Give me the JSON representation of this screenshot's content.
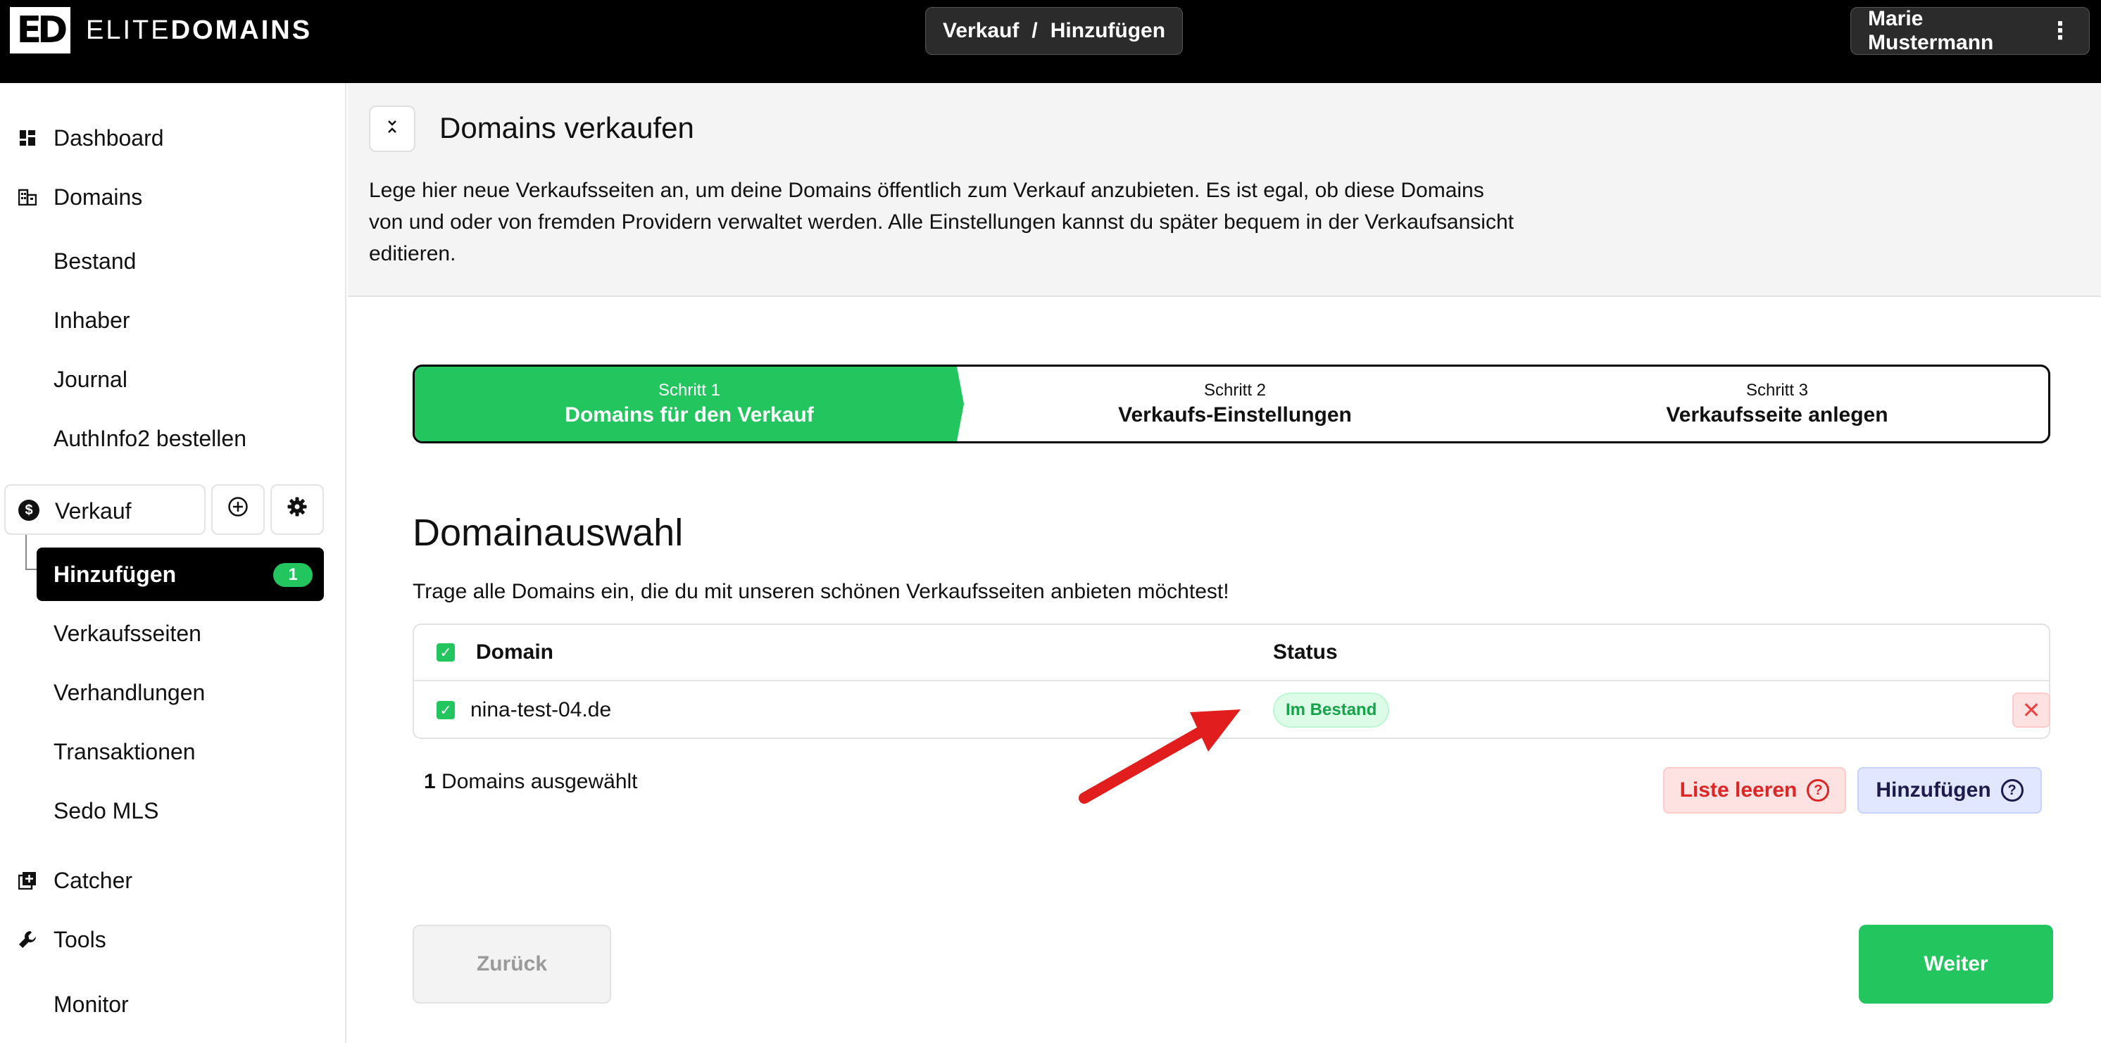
{
  "app": {
    "logo_mark": "ED",
    "logo_text_light": "ELITE",
    "logo_text_bold": "DOMAINS"
  },
  "header": {
    "breadcrumb": [
      "Verkauf",
      "Hinzufügen"
    ],
    "breadcrumb_sep": "/",
    "user_name": "Marie Mustermann"
  },
  "sidebar": {
    "dashboard": "Dashboard",
    "domains": "Domains",
    "bestand": "Bestand",
    "inhaber": "Inhaber",
    "journal": "Journal",
    "authinfo": "AuthInfo2 bestellen",
    "verkauf": "Verkauf",
    "hinzufuegen": "Hinzufügen",
    "hinzufuegen_count": "1",
    "verkaufsseiten": "Verkaufsseiten",
    "verhandlungen": "Verhandlungen",
    "transaktionen": "Transaktionen",
    "sedo": "Sedo MLS",
    "catcher": "Catcher",
    "tools": "Tools",
    "monitor": "Monitor"
  },
  "intro": {
    "title": "Domains verkaufen",
    "text": "Lege hier neue Verkaufsseiten an, um deine Domains öffentlich zum Verkauf anzubieten. Es ist egal, ob diese Domains von und oder von fremden Providern verwaltet werden. Alle Einstellungen kannst du später bequem in der Verkaufsansicht editieren."
  },
  "steps": [
    {
      "small": "Schritt 1",
      "label": "Domains für den Verkauf"
    },
    {
      "small": "Schritt 2",
      "label": "Verkaufs-Einstellungen"
    },
    {
      "small": "Schritt 3",
      "label": "Verkaufsseite anlegen"
    }
  ],
  "section": {
    "title": "Domainauswahl",
    "desc": "Trage alle Domains ein, die du mit unseren schönen Verkaufsseiten anbieten möchtest!"
  },
  "table": {
    "col_domain": "Domain",
    "col_status": "Status",
    "rows": [
      {
        "domain": "nina-test-04.de",
        "status": "Im Bestand"
      }
    ]
  },
  "selection": {
    "count": "1",
    "label": "Domains ausgewählt"
  },
  "buttons": {
    "clear": "Liste leeren",
    "add": "Hinzufügen",
    "back": "Zurück",
    "next": "Weiter"
  },
  "colors": {
    "accent": "#22c55e",
    "danger": "#ef4444",
    "annotation": "#e11d1d"
  }
}
